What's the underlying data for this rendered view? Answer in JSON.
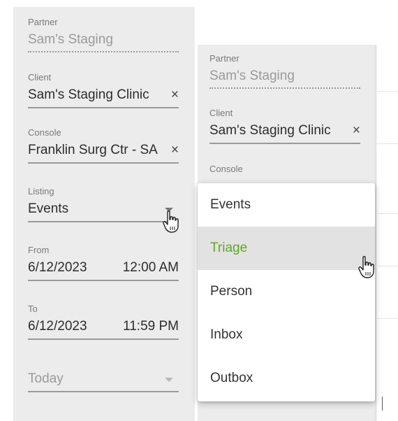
{
  "left_form": {
    "partner": {
      "label": "Partner",
      "value": "Sam's Staging"
    },
    "client": {
      "label": "Client",
      "value": "Sam's Staging Clinic",
      "clear": "×"
    },
    "console": {
      "label": "Console",
      "value": "Franklin Surg Ctr - SA",
      "clear": "×"
    },
    "listing": {
      "label": "Listing",
      "value": "Events"
    },
    "from": {
      "label": "From",
      "date": "6/12/2023",
      "time": "12:00 AM"
    },
    "to": {
      "label": "To",
      "date": "6/12/2023",
      "time": "11:59 PM"
    },
    "range": {
      "value": "Today"
    }
  },
  "right_form": {
    "partner": {
      "label": "Partner",
      "value": "Sam's Staging"
    },
    "client": {
      "label": "Client",
      "value": "Sam's Staging Clinic",
      "clear": "×"
    },
    "console": {
      "label": "Console"
    }
  },
  "listing_menu": {
    "items": [
      "Events",
      "Triage",
      "Person",
      "Inbox",
      "Outbox"
    ],
    "highlighted": "Triage"
  },
  "colors": {
    "highlight_text": "#5fa821",
    "panel_bg": "#ececec"
  },
  "icons": {
    "cursor": "hand-pointer-icon",
    "dropdown": "dropdown-arrow-icon",
    "clear": "close-icon"
  }
}
